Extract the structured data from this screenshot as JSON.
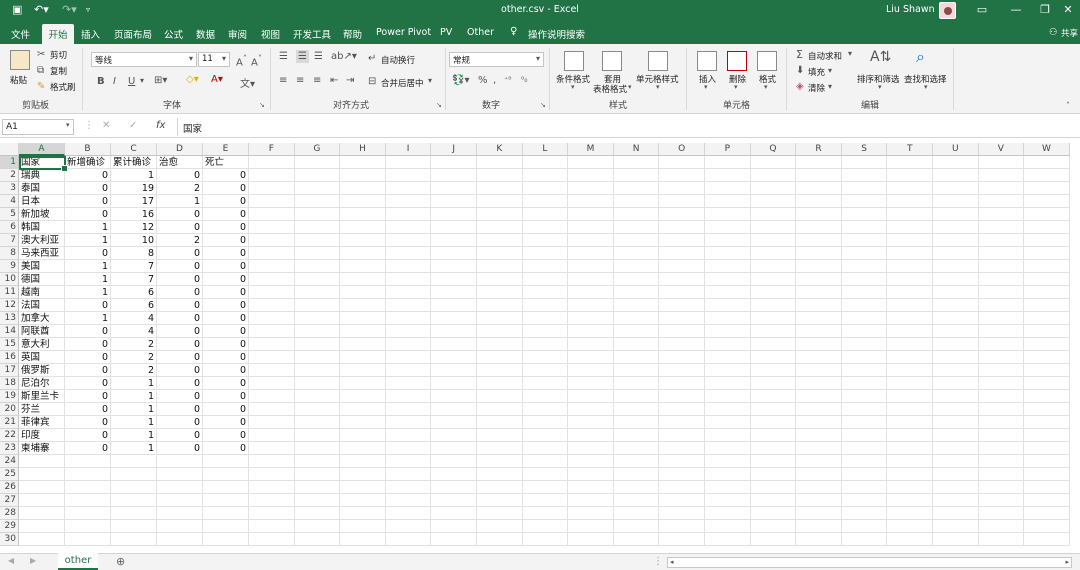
{
  "window": {
    "title": "other.csv - Excel",
    "user": "Liu Shawn"
  },
  "tabs": [
    "文件",
    "开始",
    "插入",
    "页面布局",
    "公式",
    "数据",
    "审阅",
    "视图",
    "开发工具",
    "帮助",
    "Power Pivot",
    "PV",
    "Other",
    "操作说明搜索"
  ],
  "share_label": "共享",
  "ribbon": {
    "clipboard": {
      "paste": "粘贴",
      "cut": "剪切",
      "copy": "复制",
      "painter": "格式刷",
      "label": "剪贴板"
    },
    "font": {
      "name": "等线",
      "size": "11",
      "label": "字体"
    },
    "alignment": {
      "wrap": "自动换行",
      "merge": "合并后居中",
      "label": "对齐方式"
    },
    "number": {
      "format": "常规",
      "label": "数字"
    },
    "styles": {
      "cond": "条件格式",
      "table_a": "套用",
      "table_b": "表格格式",
      "cell_styles": "单元格样式",
      "label": "样式"
    },
    "cells": {
      "insert": "插入",
      "delete": "删除",
      "format": "格式",
      "label": "单元格"
    },
    "editing": {
      "autosum": "自动求和",
      "fill": "填充",
      "clear": "清除",
      "sort": "排序和筛选",
      "find": "查找和选择",
      "label": "编辑"
    }
  },
  "formula_bar": {
    "name_box": "A1",
    "value": "国家"
  },
  "columns": [
    "A",
    "B",
    "C",
    "D",
    "E",
    "F",
    "G",
    "H",
    "I",
    "J",
    "K",
    "L",
    "M",
    "N",
    "O",
    "P",
    "Q",
    "R",
    "S",
    "T",
    "U",
    "V",
    "W"
  ],
  "header_row": [
    "国家",
    "新增确诊",
    "累计确诊",
    "治愈",
    "死亡"
  ],
  "rows": [
    [
      "瑞典",
      "0",
      "1",
      "0",
      "0"
    ],
    [
      "泰国",
      "0",
      "19",
      "2",
      "0"
    ],
    [
      "日本",
      "0",
      "17",
      "1",
      "0"
    ],
    [
      "新加坡",
      "0",
      "16",
      "0",
      "0"
    ],
    [
      "韩国",
      "1",
      "12",
      "0",
      "0"
    ],
    [
      "澳大利亚",
      "1",
      "10",
      "2",
      "0"
    ],
    [
      "马来西亚",
      "0",
      "8",
      "0",
      "0"
    ],
    [
      "美国",
      "1",
      "7",
      "0",
      "0"
    ],
    [
      "德国",
      "1",
      "7",
      "0",
      "0"
    ],
    [
      "越南",
      "1",
      "6",
      "0",
      "0"
    ],
    [
      "法国",
      "0",
      "6",
      "0",
      "0"
    ],
    [
      "加拿大",
      "1",
      "4",
      "0",
      "0"
    ],
    [
      "阿联酋",
      "0",
      "4",
      "0",
      "0"
    ],
    [
      "意大利",
      "0",
      "2",
      "0",
      "0"
    ],
    [
      "英国",
      "0",
      "2",
      "0",
      "0"
    ],
    [
      "俄罗斯",
      "0",
      "2",
      "0",
      "0"
    ],
    [
      "尼泊尔",
      "0",
      "1",
      "0",
      "0"
    ],
    [
      "斯里兰卡",
      "0",
      "1",
      "0",
      "0"
    ],
    [
      "芬兰",
      "0",
      "1",
      "0",
      "0"
    ],
    [
      "菲律宾",
      "0",
      "1",
      "0",
      "0"
    ],
    [
      "印度",
      "0",
      "1",
      "0",
      "0"
    ],
    [
      "柬埔寨",
      "0",
      "1",
      "0",
      "0"
    ]
  ],
  "row_numbers": [
    "1",
    "2",
    "3",
    "4",
    "5",
    "6",
    "7",
    "8",
    "9",
    "10",
    "11",
    "12",
    "13",
    "14",
    "15",
    "16",
    "17",
    "18",
    "19",
    "20",
    "21",
    "22",
    "23",
    "24",
    "25",
    "26",
    "27",
    "28",
    "29",
    "30"
  ],
  "sheet_tab": "other",
  "colors": {
    "accent": "#217346"
  }
}
